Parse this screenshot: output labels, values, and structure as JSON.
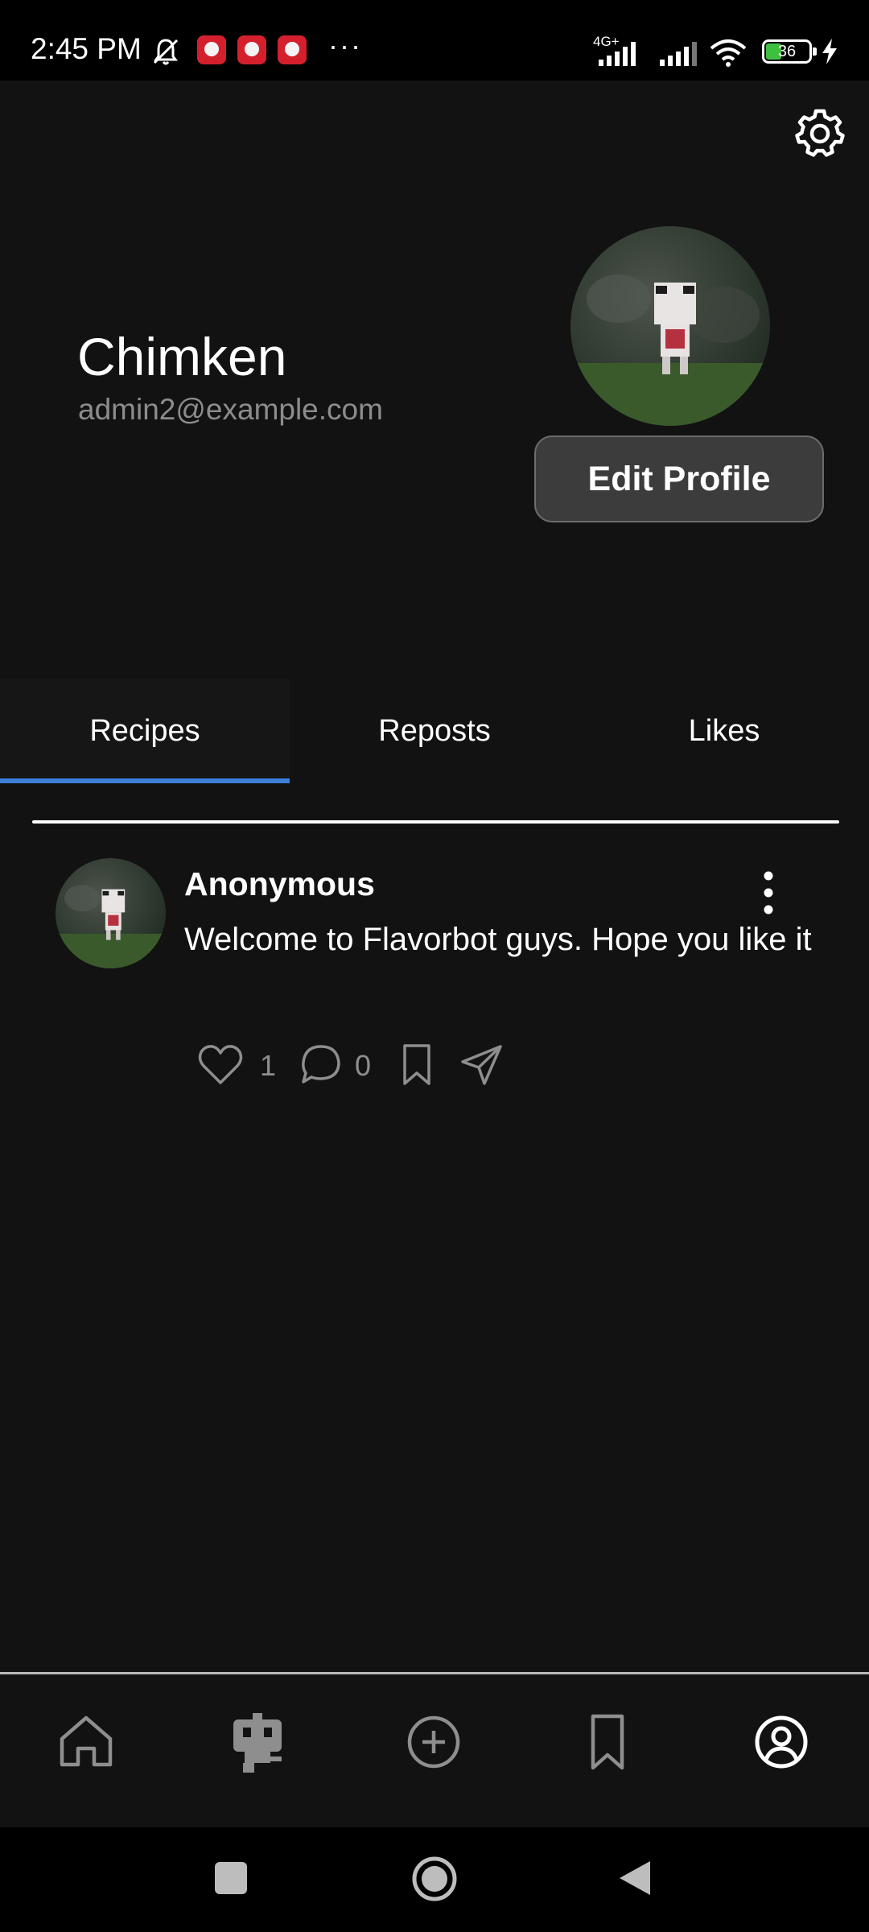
{
  "status_bar": {
    "time": "2:45 PM",
    "network_label": "4G+",
    "battery": "36",
    "battery_level": 0.36,
    "icons": [
      "mute-icon",
      "app-notification-icon",
      "app-notification-icon",
      "app-notification-icon",
      "more-dots-icon",
      "signal-icon",
      "signal-icon",
      "wifi-icon",
      "battery-icon",
      "charging-icon"
    ]
  },
  "header": {
    "settings_icon": "gear-icon"
  },
  "profile": {
    "name": "Chimken",
    "email": "admin2@example.com",
    "edit_button": "Edit Profile"
  },
  "tabs": [
    {
      "label": "Recipes",
      "active": true
    },
    {
      "label": "Reposts",
      "active": false
    },
    {
      "label": "Likes",
      "active": false
    }
  ],
  "post": {
    "author": "Anonymous",
    "text": "Welcome to Flavorbot guys. Hope you like it",
    "likes": "1",
    "comments": "0",
    "icons": [
      "heart-icon",
      "comment-icon",
      "bookmark-icon",
      "share-icon",
      "more-vertical-icon"
    ]
  },
  "bottom_nav": [
    "home-icon",
    "robot-icon",
    "add-circle-icon",
    "bookmark-icon",
    "profile-icon"
  ],
  "system_nav": [
    "recents-icon",
    "home-circle-icon",
    "back-icon"
  ],
  "colors": {
    "background": "#121212",
    "accent": "#3b7fd9",
    "muted": "#8c8c8c"
  }
}
